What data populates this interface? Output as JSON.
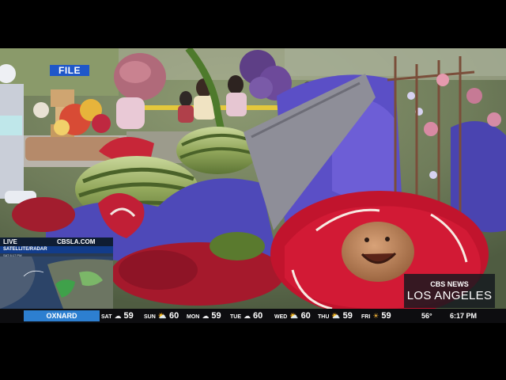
{
  "badge": {
    "label": "FILE"
  },
  "live_feed": {
    "live": "LIVE",
    "site": "CBSLA.COM",
    "panel": "SATELLITE/RADAR",
    "time": "SAT 6:17 PM"
  },
  "brand": {
    "network": "CBS NEWS",
    "city": "LOS ANGELES"
  },
  "ticker": {
    "location": "OXNARD",
    "days": [
      {
        "day": "SAT",
        "icon": "cloud-icon",
        "temp": "59"
      },
      {
        "day": "SUN",
        "icon": "sun-cloud-icon",
        "temp": "60"
      },
      {
        "day": "MON",
        "icon": "cloud-icon",
        "temp": "59"
      },
      {
        "day": "TUE",
        "icon": "cloud-icon",
        "temp": "60"
      },
      {
        "day": "WED",
        "icon": "sun-cloud-icon",
        "temp": "60"
      },
      {
        "day": "THU",
        "icon": "sun-cloud-icon",
        "temp": "59"
      },
      {
        "day": "FRI",
        "icon": "sun-icon",
        "temp": "59"
      }
    ],
    "current_temp": "56°",
    "clock": "6:17 PM"
  }
}
